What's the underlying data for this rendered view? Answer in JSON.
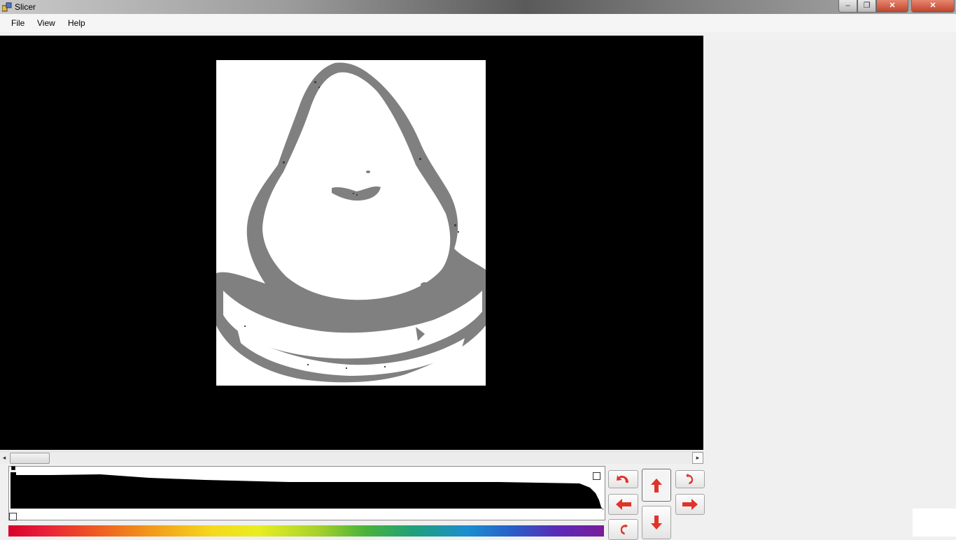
{
  "window": {
    "title": "Slicer",
    "minimize_label": "‒",
    "maximize_label": "❐",
    "close_label": "✕"
  },
  "menu": {
    "items": [
      "File",
      "View",
      "Help"
    ]
  },
  "viewer": {
    "background": "#000000",
    "slice_background": "#ffffff",
    "tissue_color": "#808080"
  },
  "scrollbar": {
    "left_arrow": "◂",
    "right_arrow": "▸"
  },
  "nav": {
    "icons": [
      "rotate-ccw-icon",
      "arrow-up-icon",
      "rotate-cw-icon",
      "arrow-left-icon",
      "arrow-right-icon",
      "flip-icon",
      "arrow-down-icon"
    ],
    "accent": "#e0332a"
  }
}
